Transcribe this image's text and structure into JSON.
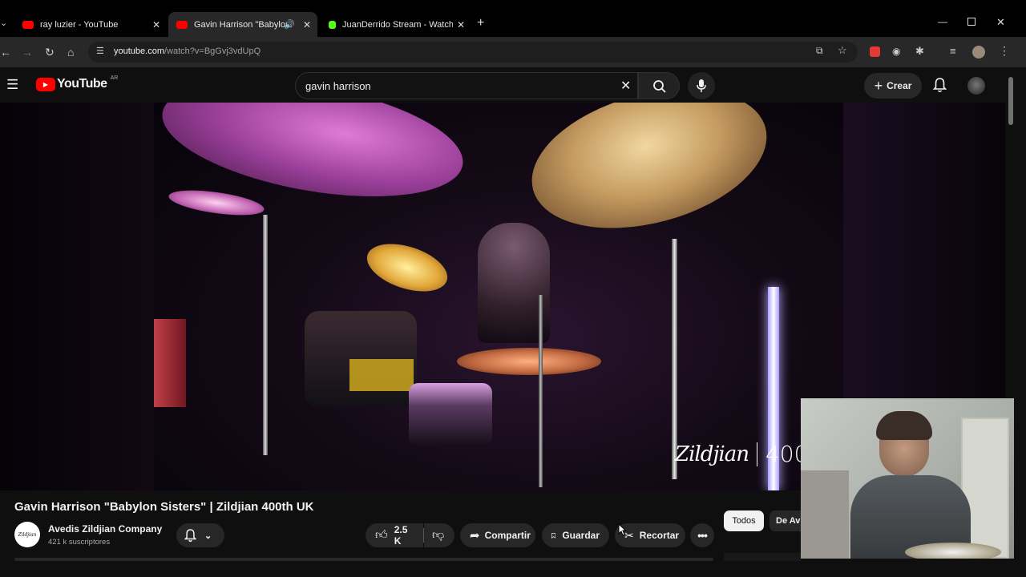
{
  "browser": {
    "tabs": [
      {
        "title": "ray luzier - YouTube",
        "color": "#ff0000"
      },
      {
        "title": "Gavin Harrison \"Babylon Si",
        "color": "#ff0000"
      },
      {
        "title": "JuanDerrido Stream - Watch Li",
        "color": "#53fc18"
      }
    ],
    "url_host": "youtube.com",
    "url_path": "/watch?v=BgGvj3vdUpQ"
  },
  "youtube": {
    "logo_text": "YouTube",
    "country": "AR",
    "search_value": "gavin harrison",
    "create_label": "Crear"
  },
  "video": {
    "watermark_brand": "Zildjian",
    "watermark_number": "400",
    "title": "Gavin Harrison \"Babylon Sisters\" | Zildjian 400th UK"
  },
  "channel": {
    "name": "Avedis Zildjian Company",
    "subscribers": "421 k suscriptores",
    "avatar_text": "Zildjian"
  },
  "actions": {
    "likes": "2.5 K",
    "share": "Compartir",
    "save": "Guardar",
    "clip": "Recortar"
  },
  "chips": {
    "all": "Todos",
    "next": "De Av"
  },
  "colors": {
    "youtube_red": "#ff0000",
    "kick_green": "#53fc18"
  }
}
